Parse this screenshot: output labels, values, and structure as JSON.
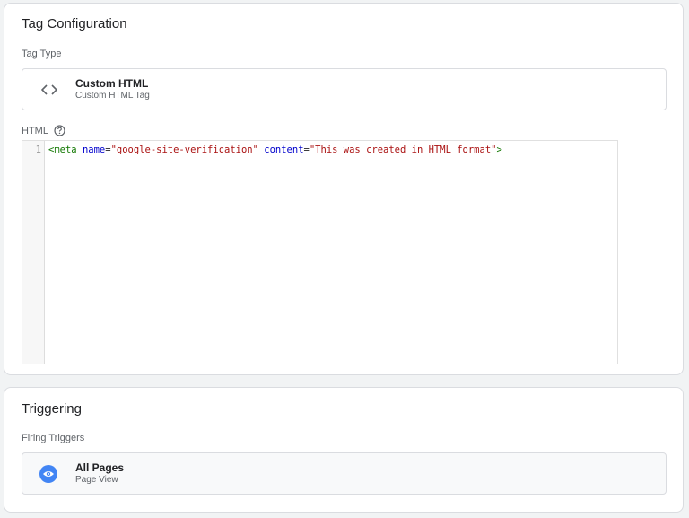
{
  "tag_configuration": {
    "title": "Tag Configuration",
    "tag_type_label": "Tag Type",
    "tag_type": {
      "icon": "code-brackets-icon",
      "name": "Custom HTML",
      "subtitle": "Custom HTML Tag"
    },
    "html_label": "HTML",
    "help_icon": "help-circle-icon",
    "editor": {
      "line_number": "1",
      "tokens": {
        "open_tag": "<meta",
        "attr1": "name",
        "eq1": "=",
        "val1": "\"google-site-verification\"",
        "attr2": "content",
        "eq2": "=",
        "val2": "\"This was created in HTML format\"",
        "close_tag": ">"
      }
    }
  },
  "triggering": {
    "title": "Triggering",
    "firing_triggers_label": "Firing Triggers",
    "trigger": {
      "icon": "eye-icon",
      "name": "All Pages",
      "subtitle": "Page View"
    }
  },
  "colors": {
    "trigger_icon_bg": "#4285f4",
    "tag_token": "#117700",
    "attr_token": "#0000cc",
    "string_token": "#aa1111"
  }
}
